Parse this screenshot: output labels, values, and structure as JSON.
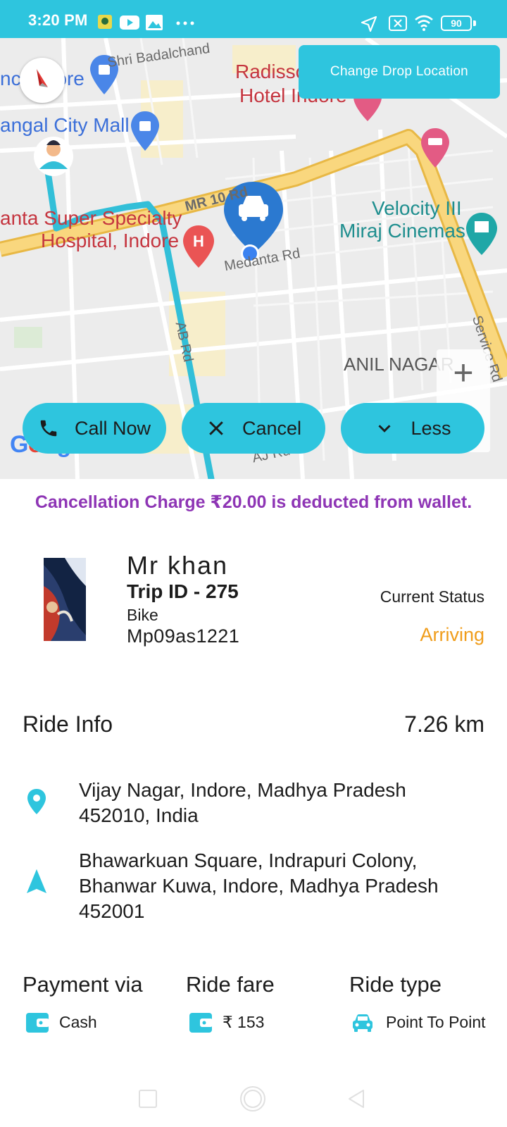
{
  "status_bar": {
    "time": "3:20 PM",
    "battery": "90"
  },
  "map": {
    "labels": {
      "store": "nce Store",
      "road_top": "Shri Badalchand",
      "radisson_1": "Radisson",
      "radisson_2": "Hotel Indore",
      "mall": "angal City Mall",
      "mr10": "MR 10 Rd",
      "hospital_1": "anta Super Specialty",
      "hospital_2": "Hospital, Indore",
      "medanta_rd": "Medanta Rd",
      "velocity_1": "Velocity III",
      "velocity_2": "Miraj Cinemas",
      "ab_rd": "AB Rd",
      "anil_nagar": "ANIL NAGAR",
      "service_rd": "Service Rd",
      "aj_rd": "AJ Rd",
      "google": "Google"
    },
    "change_drop_label": "Change Drop Location",
    "zoom_in": "+"
  },
  "actions": {
    "call_label": "Call Now",
    "cancel_label": "Cancel",
    "less_label": "Less"
  },
  "notice": "Cancellation Charge ₹20.00 is deducted from wallet.",
  "driver": {
    "name": "Mr khan",
    "trip_id": "Trip ID - 275",
    "vehicle_type": "Bike",
    "vehicle_number": "Mp09as1221",
    "status_label": "Current Status",
    "status_value": "Arriving"
  },
  "ride_info": {
    "title": "Ride Info",
    "distance": "7.26 km",
    "pickup": "Vijay Nagar, Indore, Madhya Pradesh 452010, India",
    "drop": "Bhawarkuan Square, Indrapuri Colony, Bhanwar Kuwa, Indore, Madhya Pradesh 452001"
  },
  "summary": {
    "payment_title": "Payment via",
    "payment_value": "Cash",
    "fare_title": "Ride fare",
    "fare_value": "₹ 153",
    "type_title": "Ride type",
    "type_value": "Point To Point"
  },
  "colors": {
    "accent": "#2ec5de",
    "notice": "#8e35b5",
    "status": "#f09d1b",
    "marker": "#2b79d0"
  }
}
